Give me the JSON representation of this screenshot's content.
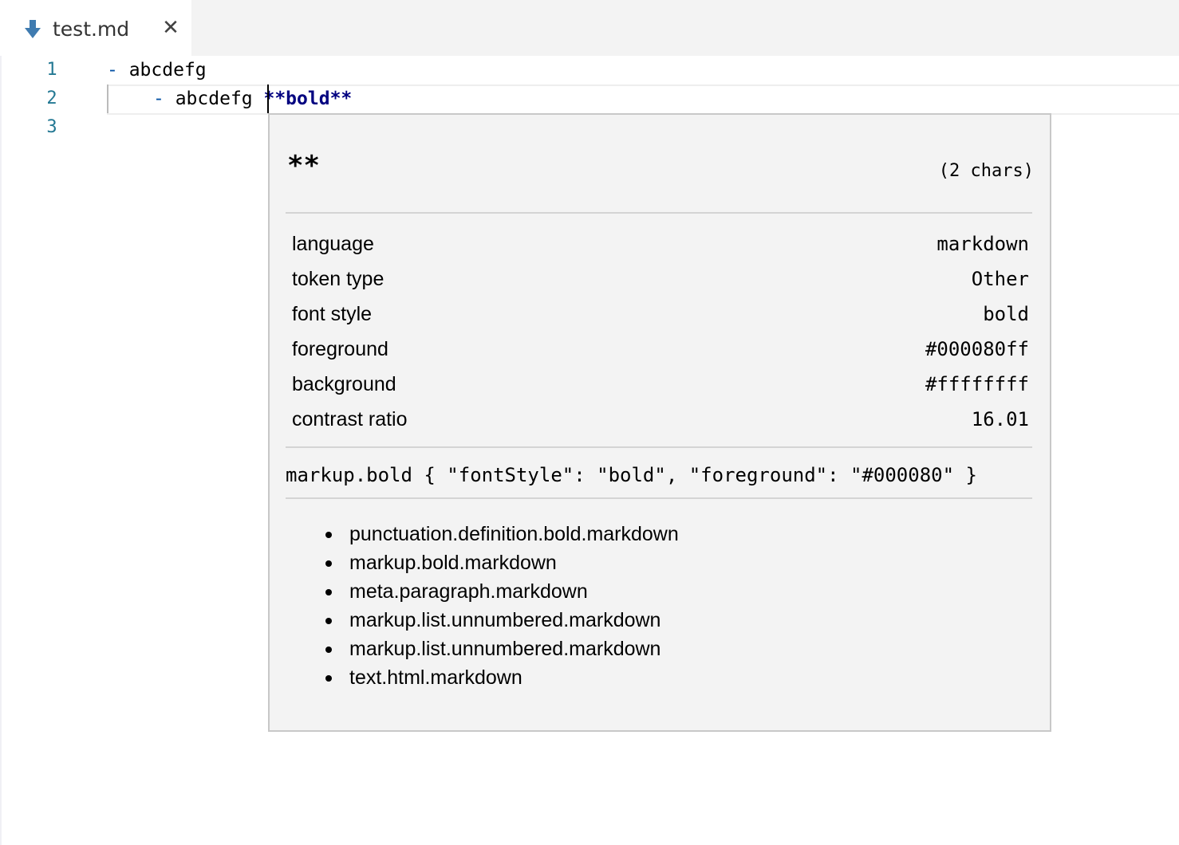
{
  "tab": {
    "label": "test.md",
    "icon": "markdown-down-arrow-icon",
    "close_glyph": "✕",
    "icon_color": "#3f7bb0"
  },
  "editor": {
    "line_numbers": [
      "1",
      "2",
      "3"
    ],
    "lines": [
      {
        "dash": "- ",
        "text": "abcdefg",
        "indent": ""
      },
      {
        "dash": "- ",
        "text": "abcdefg ",
        "indent": "  ",
        "bold_md": "**bold**"
      },
      {
        "dash": "",
        "text": "",
        "indent": ""
      }
    ],
    "colors": {
      "line_number": "#237893",
      "bold_token": "#000080",
      "dash": "#0451a5"
    }
  },
  "hover": {
    "token": "**",
    "chars": "(2 chars)",
    "properties": [
      {
        "key": "language",
        "value": "markdown"
      },
      {
        "key": "token type",
        "value": "Other"
      },
      {
        "key": "font style",
        "value": "bold"
      },
      {
        "key": "foreground",
        "value": "#000080ff"
      },
      {
        "key": "background",
        "value": "#ffffffff"
      },
      {
        "key": "contrast ratio",
        "value": "16.01"
      }
    ],
    "theme_rule": "markup.bold { \"fontStyle\": \"bold\", \"foreground\": \"#000080\" }",
    "scopes": [
      "punctuation.definition.bold.markdown",
      "markup.bold.markdown",
      "meta.paragraph.markdown",
      "markup.list.unnumbered.markdown",
      "markup.list.unnumbered.markdown",
      "text.html.markdown"
    ]
  }
}
